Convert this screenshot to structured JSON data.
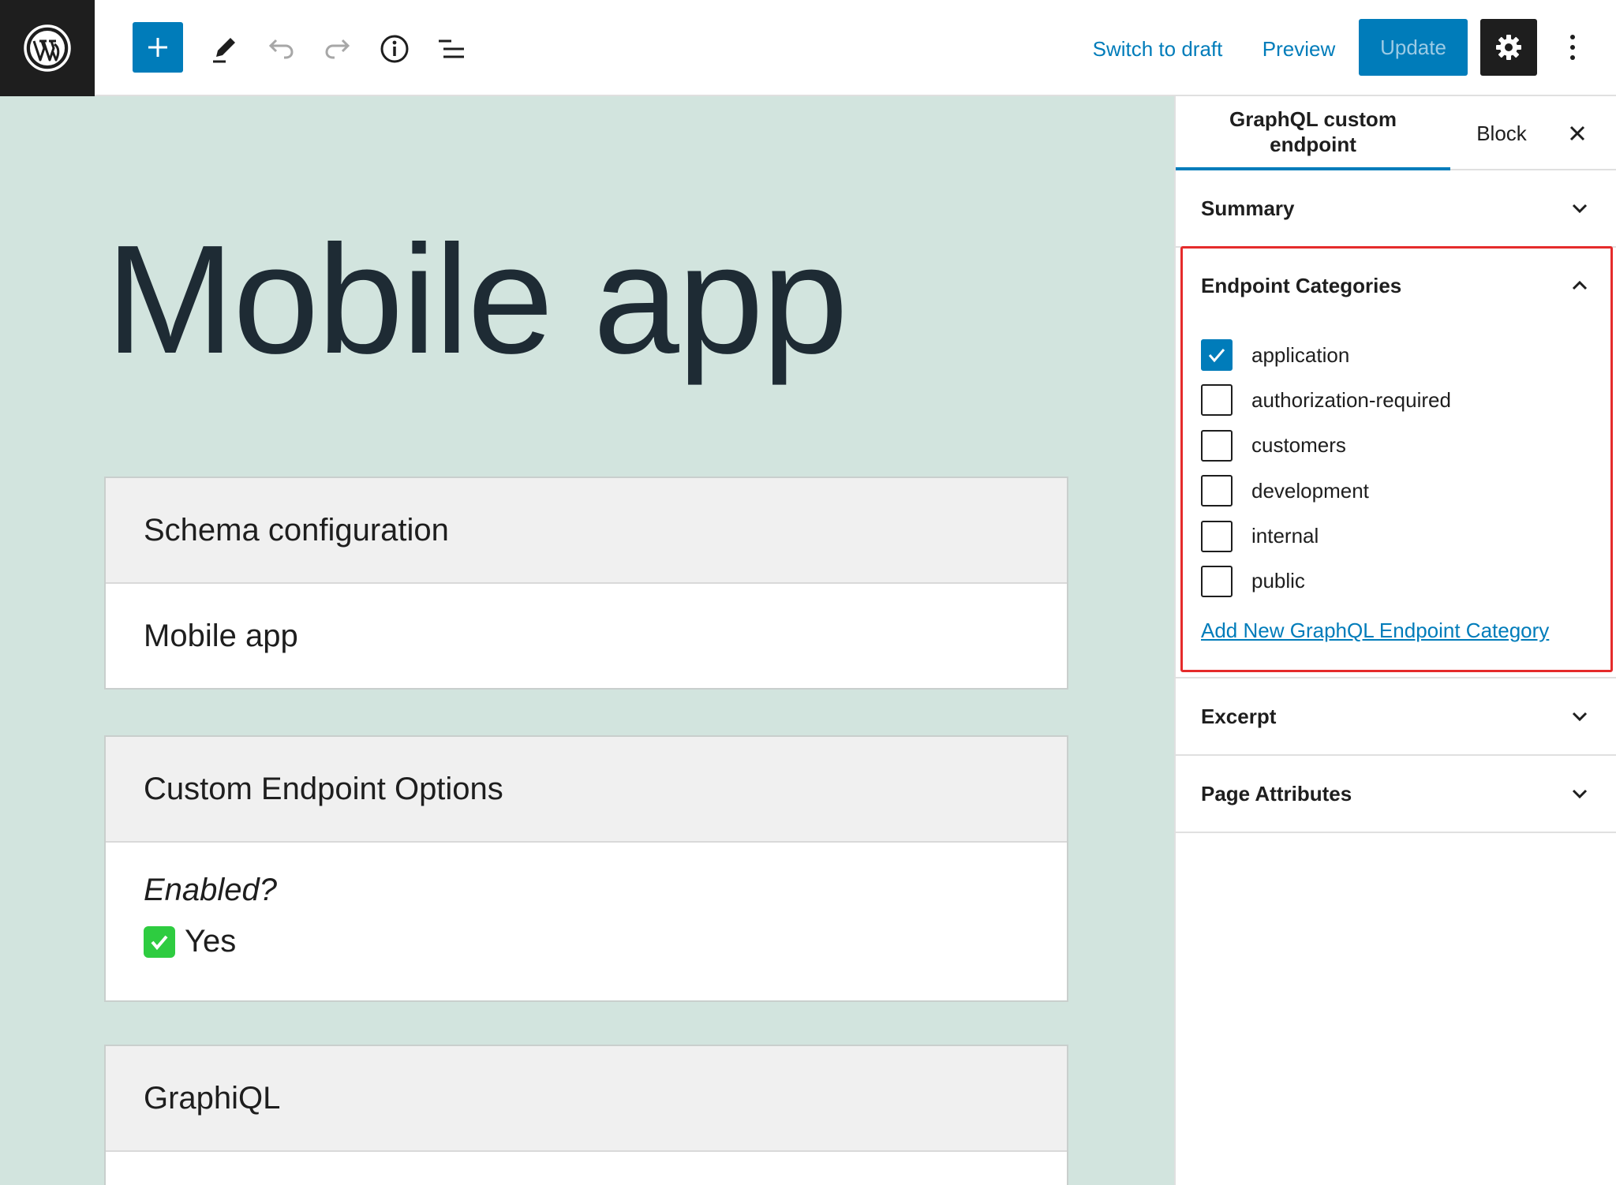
{
  "toolbar": {
    "switch_to_draft": "Switch to draft",
    "preview": "Preview",
    "update": "Update"
  },
  "editor": {
    "post_title": "Mobile app",
    "blocks": [
      {
        "heading": "Schema configuration",
        "value": "Mobile app"
      },
      {
        "heading": "Custom Endpoint Options",
        "enabled_label": "Enabled?",
        "enabled_value": "Yes"
      },
      {
        "heading": "GraphiQL"
      }
    ]
  },
  "sidebar": {
    "tabs": {
      "document": "GraphQL custom endpoint",
      "block": "Block"
    },
    "panels": {
      "summary": "Summary",
      "categories": "Endpoint Categories",
      "excerpt": "Excerpt",
      "attributes": "Page Attributes"
    },
    "categories": [
      {
        "label": "application",
        "checked": true
      },
      {
        "label": "authorization-required",
        "checked": false
      },
      {
        "label": "customers",
        "checked": false
      },
      {
        "label": "development",
        "checked": false
      },
      {
        "label": "internal",
        "checked": false
      },
      {
        "label": "public",
        "checked": false
      }
    ],
    "add_category_link": "Add New GraphQL Endpoint Category"
  },
  "colors": {
    "accent": "#007cba",
    "canvas_bg": "#d2e4de",
    "highlight": "#e52b2b",
    "dark": "#1e1e1e"
  },
  "icons": [
    "wordpress-logo-icon",
    "plus-icon",
    "pencil-icon",
    "undo-icon",
    "redo-icon",
    "info-icon",
    "list-view-icon",
    "gear-icon",
    "more-vertical-icon",
    "close-icon",
    "chevron-down-icon",
    "chevron-up-icon",
    "checkmark-icon"
  ]
}
